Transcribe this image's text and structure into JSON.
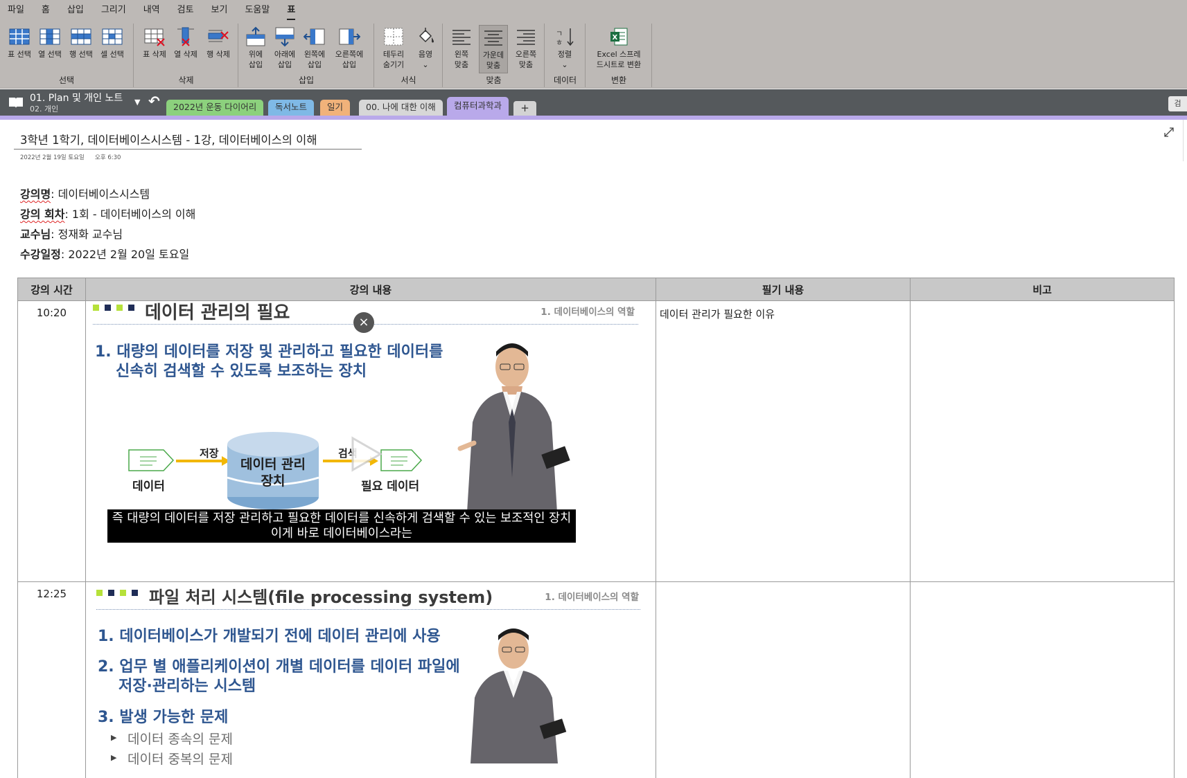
{
  "menu": {
    "items": [
      "파일",
      "홈",
      "삽입",
      "그리기",
      "내역",
      "검토",
      "보기",
      "도움말",
      "표"
    ]
  },
  "ribbon": {
    "groups": {
      "select": {
        "label": "선택",
        "buttons": [
          "표 선택",
          "열 선택",
          "행 선택",
          "셀 선택"
        ]
      },
      "delete": {
        "label": "삭제",
        "buttons": [
          "표 삭제",
          "열 삭제",
          "행 삭제"
        ]
      },
      "insert": {
        "label": "삽입",
        "buttons": [
          [
            "위에",
            "삽입"
          ],
          [
            "아래에",
            "삽입"
          ],
          [
            "왼쪽에",
            "삽입"
          ],
          [
            "오른쪽에",
            "삽입"
          ]
        ]
      },
      "format": {
        "label": "서식",
        "buttons": [
          [
            "테두리",
            "숨기기"
          ],
          [
            "음영",
            "⌄"
          ]
        ]
      },
      "align": {
        "label": "맞춤",
        "buttons": [
          [
            "왼쪽",
            "맞춤"
          ],
          [
            "가운데",
            "맞춤"
          ],
          [
            "오른쪽",
            "맞춤"
          ]
        ]
      },
      "data": {
        "label": "데이터",
        "buttons": [
          [
            "정렬",
            "⌄"
          ]
        ]
      },
      "convert": {
        "label": "변환",
        "buttons": [
          [
            "Excel 스프레",
            "드시트로 변환"
          ]
        ]
      }
    }
  },
  "notebook": {
    "title": "01. Plan 및 개인 노트",
    "subtitle": "02. 개인",
    "sections": [
      {
        "label": "2022년 운동 다이어리",
        "color": "#8cd17d"
      },
      {
        "label": "독서노트",
        "color": "#7fb9e6"
      },
      {
        "label": "일기",
        "color": "#f1b27a"
      },
      {
        "label": "00. 나에 대한 이해",
        "color": "#d7d7d7"
      },
      {
        "label": "컴퓨터과학과",
        "color": "#b9a9ea"
      }
    ],
    "add_label": "+",
    "search_stub": "검"
  },
  "page": {
    "title": "3학년 1학기, 데이터베이스시스템 - 1강, 데이터베이스의 이해",
    "date": "2022년 2월 19일 토요일",
    "time": "오후 6:30",
    "info": [
      {
        "key": "강의명",
        "value": ": 데이터베이스시스템"
      },
      {
        "key": "강의 회차",
        "value": ": 1회 - 데이터베이스의 이해"
      },
      {
        "key": "교수님",
        "value": ": 정재화 교수님"
      },
      {
        "key": "수강일정",
        "value": ": 2022년 2월 20일 토요일"
      }
    ]
  },
  "table": {
    "headers": [
      "강의 시간",
      "강의 내용",
      "필기 내용",
      "비고"
    ],
    "rows": [
      {
        "time": "10:20",
        "notes": "데이터 관리가 필요한 이유",
        "remark": "",
        "slide": {
          "title": "데이터 관리의 필요",
          "crumb": "1. 데이터베이스의 역할",
          "bullet1a": "1. 대량의 데이터를 저장 및 관리하고 필요한 데이터를",
          "bullet1b": "신속히 검색할 수 있도록 보조하는 장치",
          "arrow_store": "저장",
          "arrow_search": "검색",
          "data_label": "데이터",
          "db_label1": "데이터 관리",
          "db_label2": "장치",
          "needed_label": "필요 데이터",
          "caption1": "즉 대량의 데이터를 저장 관리하고 필요한 데이터를 신속하게 검색할 수 있는 보조적인 장치",
          "caption2": "이게 바로 데이터베이스라는",
          "close": "×"
        }
      },
      {
        "time": "12:25",
        "notes": "",
        "remark": "",
        "slide": {
          "title": "파일 처리 시스템(file processing system)",
          "crumb": "1. 데이터베이스의 역할",
          "b1": "1. 데이터베이스가 개발되기 전에 데이터 관리에 사용",
          "b2a": "2. 업무 별 애플리케이션이 개별 데이터를 데이터 파일에",
          "b2b": "저장·관리하는 시스템",
          "b3": "3. 발생 가능한 문제",
          "s1": "데이터 종속의 문제",
          "s2": "데이터 중복의 문제"
        }
      }
    ]
  },
  "colors": {
    "ribbon_bg": "#bdb9b6",
    "tabbar_bg": "#55595c",
    "accent": "#b9a9ea",
    "slide_blue": "#2e5690",
    "slide_green": "#b6e13a",
    "slide_navy": "#1f2d57"
  }
}
